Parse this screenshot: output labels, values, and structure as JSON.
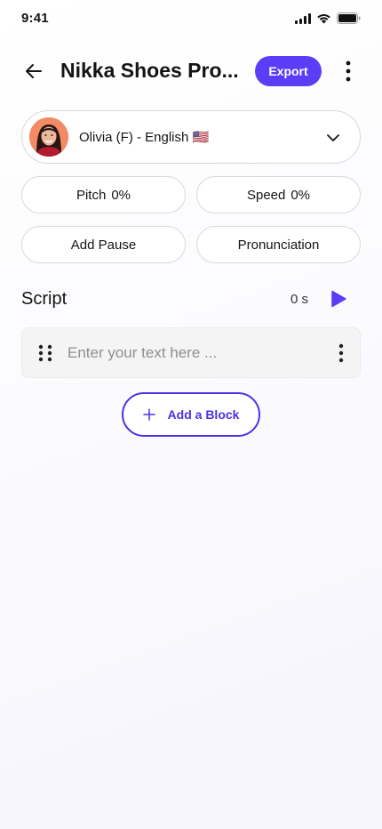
{
  "status_bar": {
    "time": "9:41"
  },
  "header": {
    "title": "Nikka Shoes Pro...",
    "export_label": "Export"
  },
  "voice": {
    "label": "Olivia (F) - English 🇺🇸"
  },
  "controls": {
    "pitch_label": "Pitch",
    "pitch_value": "0%",
    "speed_label": "Speed",
    "speed_value": "0%",
    "add_pause_label": "Add Pause",
    "pronunciation_label": "Pronunciation"
  },
  "script": {
    "title": "Script",
    "duration": "0 s",
    "block_placeholder": "Enter your text here ...",
    "add_block_label": "Add a Block"
  },
  "colors": {
    "accent": "#5b3df5",
    "accent_outline": "#4a33e0",
    "play": "#5b3df5"
  },
  "icons": {
    "back": "arrow-left-icon",
    "more": "more-vertical-icon",
    "chevron": "chevron-down-icon",
    "play": "play-icon",
    "drag": "drag-handle-icon",
    "add": "plus-icon"
  }
}
